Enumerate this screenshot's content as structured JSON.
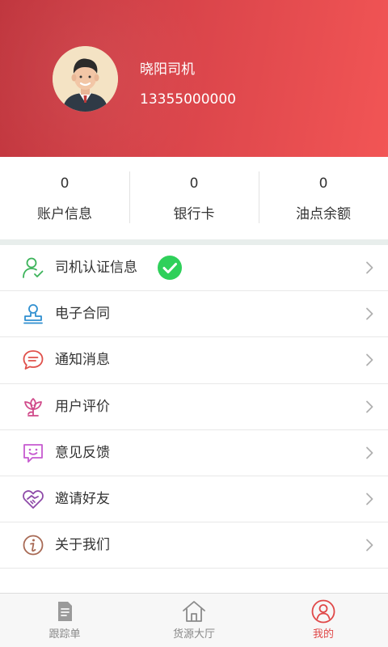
{
  "profile": {
    "name": "晓阳司机",
    "phone": "13355000000",
    "avatar_icon": "driver-avatar-icon"
  },
  "stats": [
    {
      "value": "0",
      "label": "账户信息"
    },
    {
      "value": "0",
      "label": "银行卡"
    },
    {
      "value": "0",
      "label": "油点余额"
    }
  ],
  "menu": [
    {
      "label": "司机认证信息",
      "icon": "user-verify-icon",
      "verified": true
    },
    {
      "label": "电子合同",
      "icon": "stamp-icon"
    },
    {
      "label": "通知消息",
      "icon": "chat-bubble-icon"
    },
    {
      "label": "用户评价",
      "icon": "lotus-icon"
    },
    {
      "label": "意见反馈",
      "icon": "feedback-smile-icon"
    },
    {
      "label": "邀请好友",
      "icon": "handshake-heart-icon"
    },
    {
      "label": "关于我们",
      "icon": "info-icon"
    }
  ],
  "tabs": [
    {
      "label": "跟踪单",
      "icon": "document-icon",
      "active": false
    },
    {
      "label": "货源大厅",
      "icon": "home-icon",
      "active": false
    },
    {
      "label": "我的",
      "icon": "user-circle-icon",
      "active": true
    }
  ],
  "colors": {
    "header_start": "#c0363e",
    "header_end": "#f25555",
    "accent": "#e04848",
    "verified_green": "#2fd05a"
  }
}
